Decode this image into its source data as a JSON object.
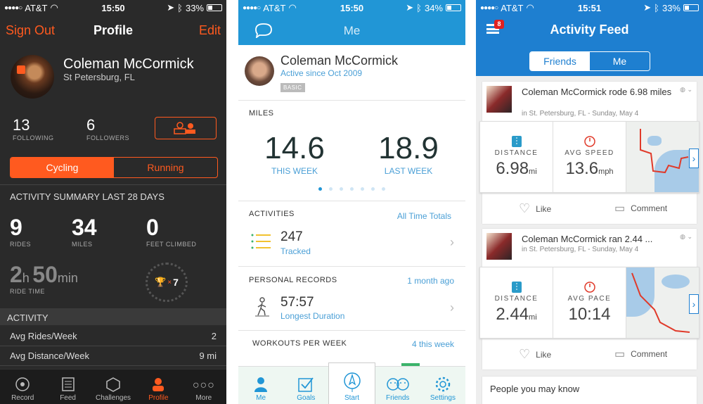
{
  "strava": {
    "status": {
      "carrier": "AT&T",
      "time": "15:50",
      "battery": "33%"
    },
    "nav": {
      "left": "Sign Out",
      "title": "Profile",
      "right": "Edit"
    },
    "profile": {
      "name": "Coleman McCormick",
      "location": "St Petersburg, FL"
    },
    "counts": {
      "following_num": "13",
      "following_label": "FOLLOWING",
      "followers_num": "6",
      "followers_label": "FOLLOWERS"
    },
    "tabs": {
      "cycling": "Cycling",
      "running": "Running"
    },
    "summary_title": "ACTIVITY SUMMARY LAST 28 DAYS",
    "stats": [
      {
        "value": "9",
        "label": "RIDES"
      },
      {
        "value": "34",
        "label": "MILES"
      },
      {
        "value": "0",
        "label": "FEET CLIMBED"
      }
    ],
    "ride_time": {
      "hours": "2",
      "h": "h",
      "minutes": "50",
      "min": "min",
      "label": "RIDE TIME"
    },
    "trophy_count": "7",
    "activity_header": "ACTIVITY",
    "activity_rows": [
      {
        "label": "Avg Rides/Week",
        "value": "2"
      },
      {
        "label": "Avg Distance/Week",
        "value": "9 mi"
      }
    ],
    "tabbar": [
      "Record",
      "Feed",
      "Challenges",
      "Profile",
      "More"
    ],
    "accent": "#ff5a1f"
  },
  "runkeeper": {
    "status": {
      "carrier": "AT&T",
      "time": "15:50",
      "battery": "34%"
    },
    "title": "Me",
    "profile": {
      "name": "Coleman McCormick",
      "since": "Active since Oct 2009",
      "badge": "BASIC"
    },
    "miles_caption": "MILES",
    "this_week": {
      "value": "14.6",
      "label": "THIS WEEK"
    },
    "last_week": {
      "value": "18.9",
      "label": "LAST WEEK"
    },
    "activities": {
      "caption": "ACTIVITIES",
      "link": "All Time Totals",
      "value": "247",
      "sub": "Tracked"
    },
    "records": {
      "caption": "PERSONAL RECORDS",
      "link": "1 month ago",
      "value": "57:57",
      "sub": "Longest Duration"
    },
    "workouts": {
      "caption": "WORKOUTS PER WEEK",
      "link": "4 this week"
    },
    "tabbar": [
      "Me",
      "Goals",
      "Start",
      "Friends",
      "Settings"
    ],
    "accent": "#2196d6"
  },
  "mapmyride": {
    "status": {
      "carrier": "AT&T",
      "time": "15:51",
      "battery": "33%"
    },
    "title": "Activity Feed",
    "badge": "8",
    "segments": {
      "friends": "Friends",
      "me": "Me"
    },
    "cards": [
      {
        "title": "Coleman McCormick rode 6.98 miles",
        "sub": "in St. Petersburg, FL - Sunday, May 4",
        "stat1_label": "DISTANCE",
        "stat1_value": "6.98",
        "stat1_unit": "mi",
        "stat2_label": "AVG SPEED",
        "stat2_value": "13.6",
        "stat2_unit": "mph",
        "like": "Like",
        "comment": "Comment"
      },
      {
        "title": "Coleman McCormick ran 2.44 ...",
        "sub": "in St. Petersburg, FL - Sunday, May 4",
        "stat1_label": "DISTANCE",
        "stat1_value": "2.44",
        "stat1_unit": "mi",
        "stat2_label": "AVG PACE",
        "stat2_value": "10:14",
        "stat2_unit": "",
        "like": "Like",
        "comment": "Comment"
      }
    ],
    "people_title": "People you may know",
    "accent": "#1e7fd0"
  }
}
